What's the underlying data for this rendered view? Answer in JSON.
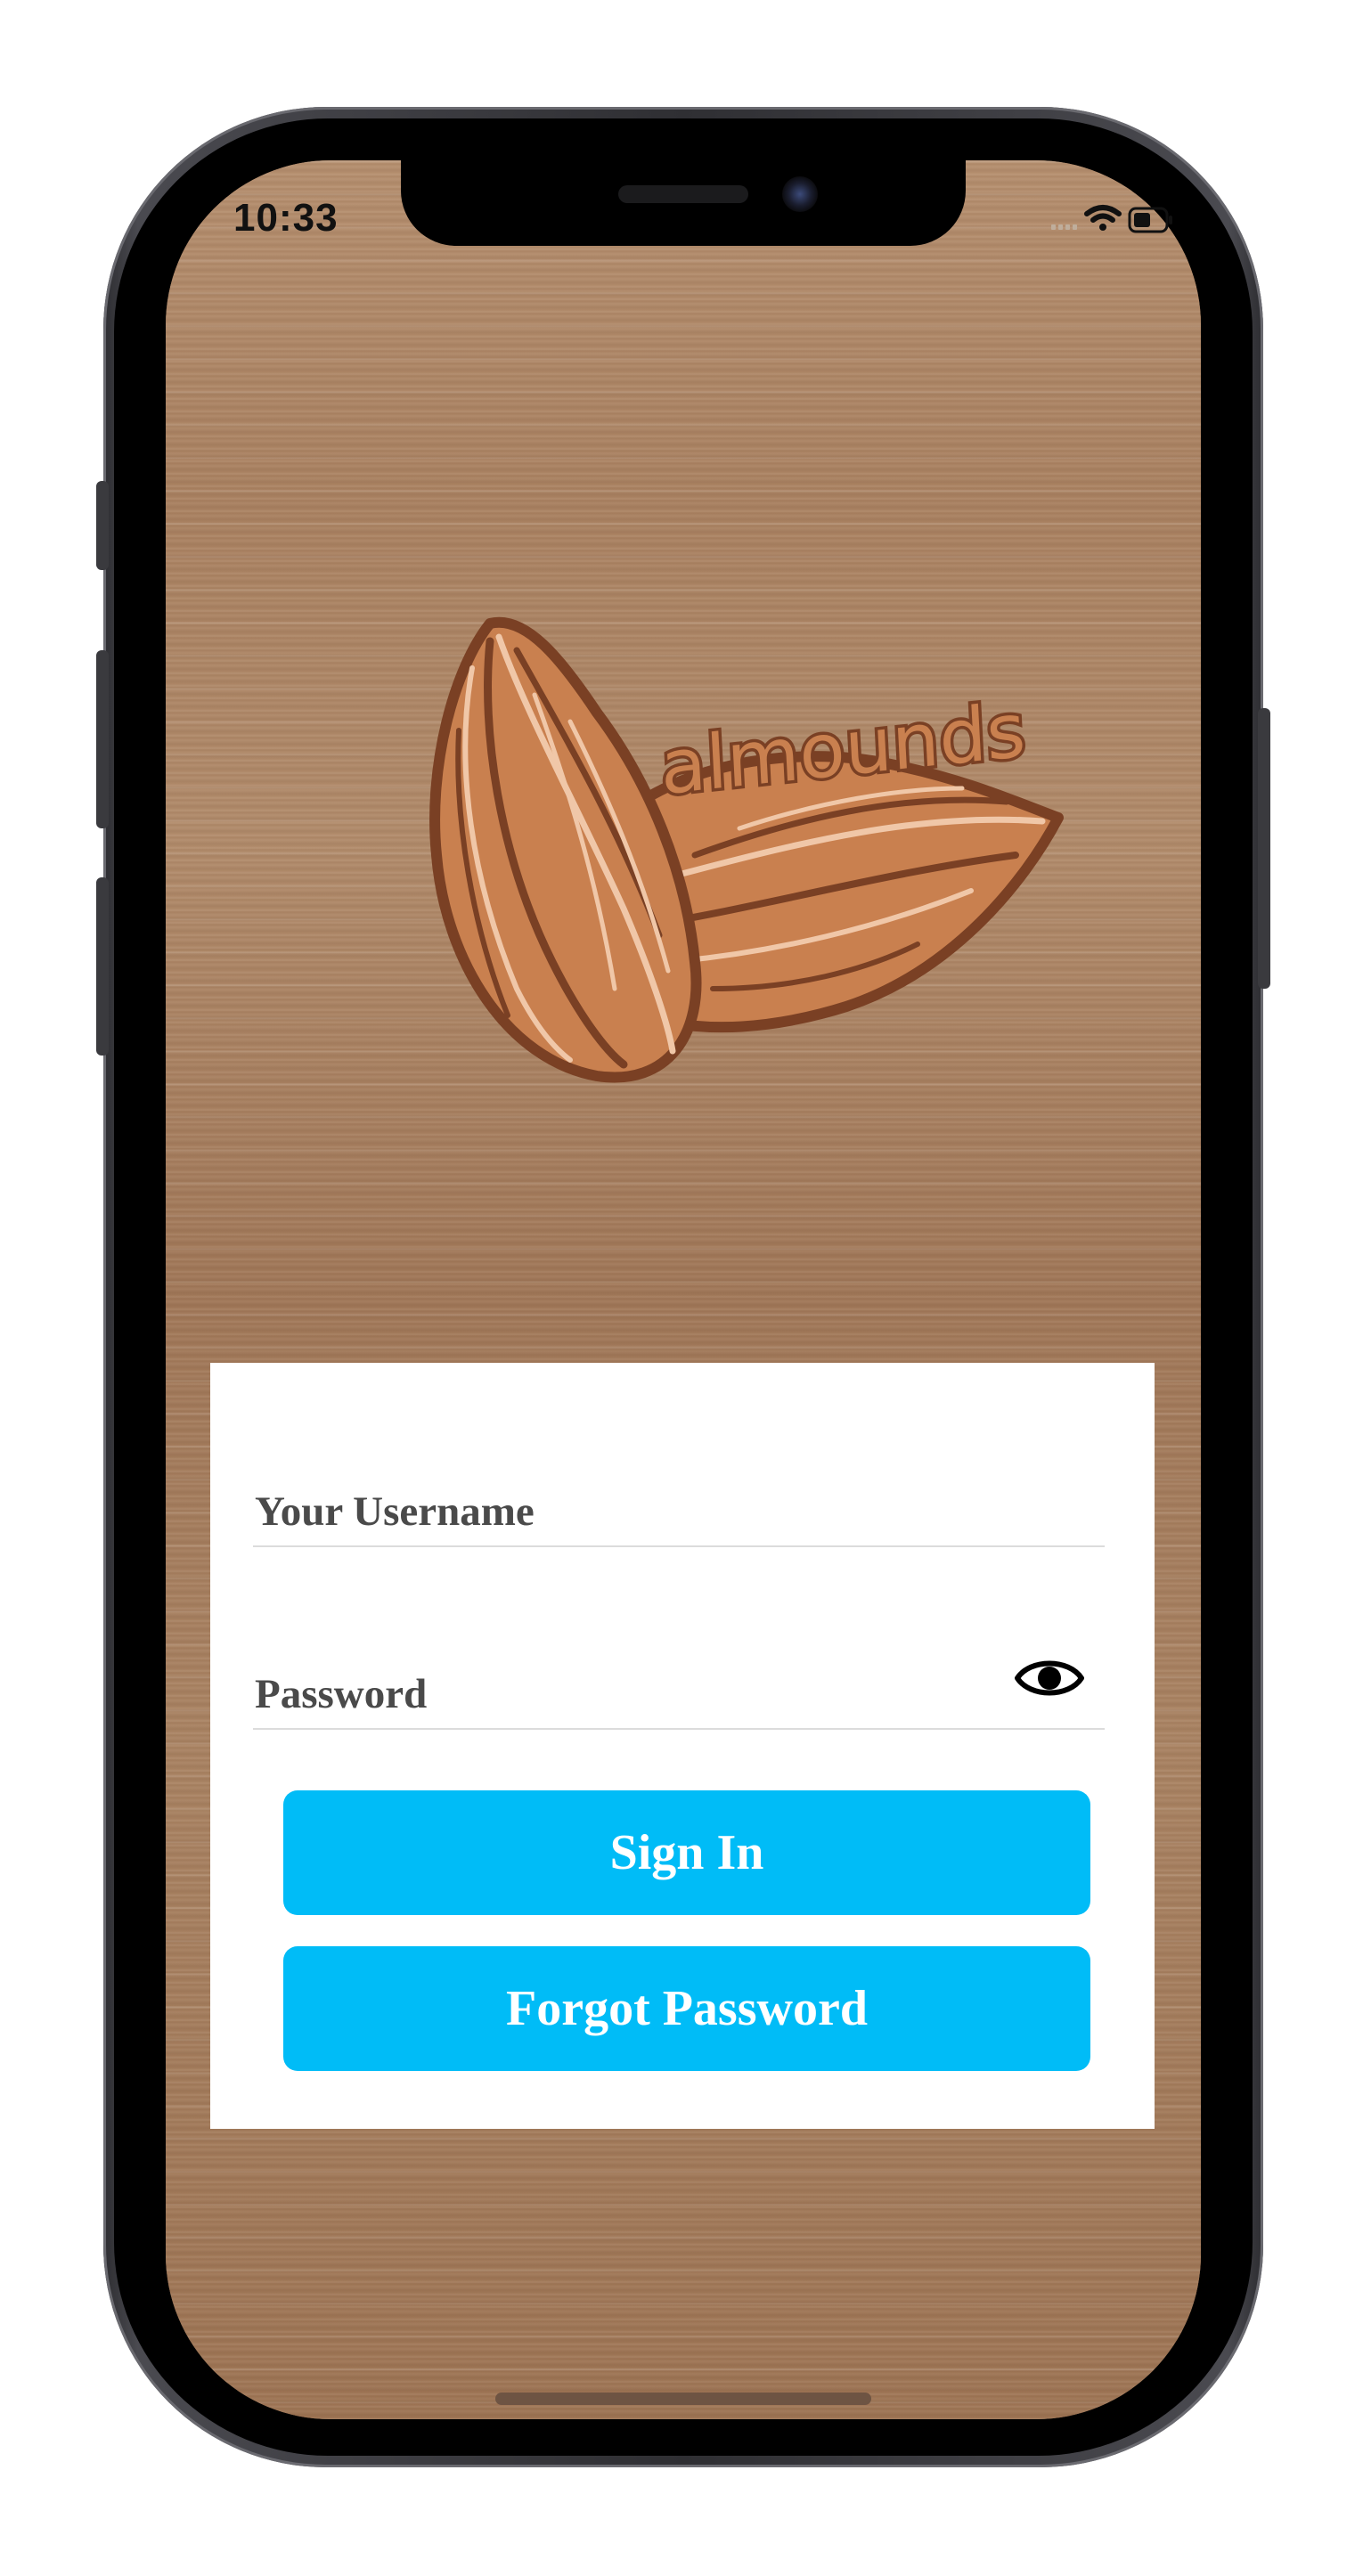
{
  "status_bar": {
    "time": "10:33"
  },
  "logo": {
    "brand_text": "almounds"
  },
  "login_form": {
    "username_label": "Your Username",
    "password_label": "Password",
    "show_password_icon": "eye-icon",
    "sign_in_label": "Sign In",
    "forgot_password_label": "Forgot Password"
  },
  "colors": {
    "button_accent": "#00bcf7",
    "almond_fill": "#c9804f",
    "almond_outline": "#7a4024",
    "wood_base": "#a77d5c"
  }
}
